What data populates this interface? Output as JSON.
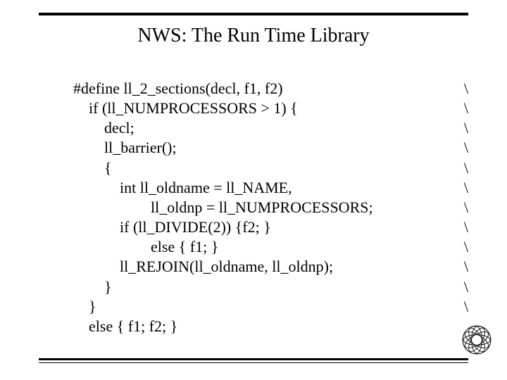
{
  "title": "NWS: The Run Time Library",
  "code": {
    "lines": [
      {
        "indent": 0,
        "text": "#define ll_2_sections(decl, f1, f2)",
        "cont": "\\"
      },
      {
        "indent": 1,
        "text": "if (ll_NUMPROCESSORS > 1) {",
        "cont": "\\"
      },
      {
        "indent": 2,
        "text": "decl;",
        "cont": "\\"
      },
      {
        "indent": 2,
        "text": "ll_barrier();",
        "cont": "\\"
      },
      {
        "indent": 2,
        "text": "{",
        "cont": "\\"
      },
      {
        "indent": 3,
        "text": "int ll_oldname = ll_NAME,",
        "cont": "\\"
      },
      {
        "indent": 5,
        "text": "ll_oldnp = ll_NUMPROCESSORS;",
        "cont": "\\"
      },
      {
        "indent": 3,
        "text": "if (ll_DIVIDE(2)) {f2; }",
        "cont": "\\"
      },
      {
        "indent": 5,
        "text": "else { f1; }",
        "cont": "\\"
      },
      {
        "indent": 3,
        "text": "ll_REJOIN(ll_oldname, ll_oldnp);",
        "cont": "\\"
      },
      {
        "indent": 2,
        "text": "}",
        "cont": "\\"
      },
      {
        "indent": 1,
        "text": "}",
        "cont": "\\"
      },
      {
        "indent": 1,
        "text": "else { f1; f2; }",
        "cont": ""
      }
    ]
  }
}
